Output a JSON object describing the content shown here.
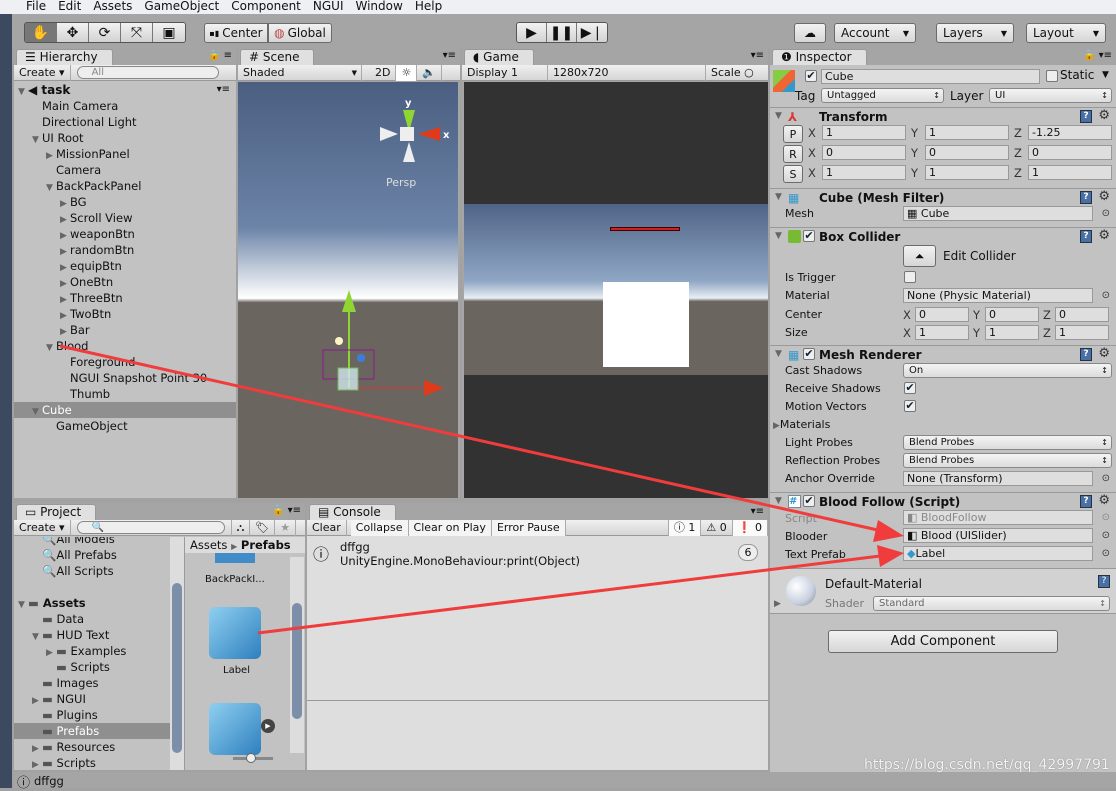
{
  "menu": [
    "File",
    "Edit",
    "Assets",
    "GameObject",
    "Component",
    "NGUI",
    "Window",
    "Help"
  ],
  "toolbar": {
    "tools": [
      "hand-tool",
      "move-tool",
      "rotate-tool",
      "scale-tool",
      "rect-tool"
    ],
    "pivot": "Center",
    "space": "Global",
    "account": "Account",
    "layers": "Layers",
    "layout": "Layout"
  },
  "hierarchy": {
    "tab": "Hierarchy",
    "create": "Create",
    "search_placeholder": "All",
    "scene": "task",
    "items": [
      {
        "label": "Main Camera",
        "depth": 1,
        "arrow": ""
      },
      {
        "label": "Directional Light",
        "depth": 1,
        "arrow": ""
      },
      {
        "label": "UI Root",
        "depth": 1,
        "arrow": "open"
      },
      {
        "label": "MissionPanel",
        "depth": 2,
        "arrow": "closed"
      },
      {
        "label": "Camera",
        "depth": 2,
        "arrow": ""
      },
      {
        "label": "BackPackPanel",
        "depth": 2,
        "arrow": "open"
      },
      {
        "label": "BG",
        "depth": 3,
        "arrow": "closed"
      },
      {
        "label": "Scroll View",
        "depth": 3,
        "arrow": "closed"
      },
      {
        "label": "weaponBtn",
        "depth": 3,
        "arrow": "closed"
      },
      {
        "label": "randomBtn",
        "depth": 3,
        "arrow": "closed"
      },
      {
        "label": "equipBtn",
        "depth": 3,
        "arrow": "closed"
      },
      {
        "label": "OneBtn",
        "depth": 3,
        "arrow": "closed"
      },
      {
        "label": "ThreeBtn",
        "depth": 3,
        "arrow": "closed"
      },
      {
        "label": "TwoBtn",
        "depth": 3,
        "arrow": "closed"
      },
      {
        "label": "Bar",
        "depth": 3,
        "arrow": "closed"
      },
      {
        "label": "Blood",
        "depth": 2,
        "arrow": "open"
      },
      {
        "label": "Foreground",
        "depth": 3,
        "arrow": ""
      },
      {
        "label": "NGUI Snapshot Point 30",
        "depth": 3,
        "arrow": ""
      },
      {
        "label": "Thumb",
        "depth": 3,
        "arrow": ""
      },
      {
        "label": "Cube",
        "depth": 1,
        "arrow": "open",
        "selected": true
      },
      {
        "label": "GameObject",
        "depth": 2,
        "arrow": ""
      }
    ]
  },
  "scene": {
    "tab": "Scene",
    "shading": "Shaded",
    "mode2d": "2D",
    "persp": "Persp",
    "axis_x": "x",
    "axis_y": "y"
  },
  "game": {
    "tab": "Game",
    "display": "Display 1",
    "resolution": "1280x720",
    "scale": "Scale"
  },
  "inspector": {
    "tab": "Inspector",
    "name": "Cube",
    "static": "Static",
    "tag_label": "Tag",
    "tag": "Untagged",
    "layer_label": "Layer",
    "layer": "UI",
    "transform": {
      "title": "Transform",
      "rows": [
        {
          "btn": "P",
          "x": "1",
          "y": "1",
          "z": "-1.25"
        },
        {
          "btn": "R",
          "x": "0",
          "y": "0",
          "z": "0"
        },
        {
          "btn": "S",
          "x": "1",
          "y": "1",
          "z": "1"
        }
      ]
    },
    "mesh_filter": {
      "title": "Cube (Mesh Filter)",
      "mesh_label": "Mesh",
      "mesh": "Cube"
    },
    "box_collider": {
      "title": "Box Collider",
      "edit": "Edit Collider",
      "is_trigger": "Is Trigger",
      "material_label": "Material",
      "material": "None (Physic Material)",
      "center_label": "Center",
      "center": [
        "0",
        "0",
        "0"
      ],
      "size_label": "Size",
      "size": [
        "1",
        "1",
        "1"
      ]
    },
    "mesh_renderer": {
      "title": "Mesh Renderer",
      "cast_label": "Cast Shadows",
      "cast": "On",
      "receive_label": "Receive Shadows",
      "motion_label": "Motion Vectors",
      "materials": "Materials",
      "light_label": "Light Probes",
      "light": "Blend Probes",
      "refl_label": "Reflection Probes",
      "refl": "Blend Probes",
      "anchor_label": "Anchor Override",
      "anchor": "None (Transform)"
    },
    "blood_follow": {
      "title": "Blood Follow (Script)",
      "script_label": "Script",
      "script": "BloodFollow",
      "blooder_label": "Blooder",
      "blooder": "Blood (UISlider)",
      "prefab_label": "Text Prefab",
      "prefab": "Label"
    },
    "material": {
      "name": "Default-Material",
      "shader_label": "Shader",
      "shader": "Standard"
    },
    "add_component": "Add Component"
  },
  "project": {
    "tab": "Project",
    "create": "Create",
    "favorites": [
      "All Models",
      "All Prefabs",
      "All Scripts"
    ],
    "tree": [
      {
        "label": "Assets",
        "depth": 0,
        "arrow": "open",
        "bold": true
      },
      {
        "label": "Data",
        "depth": 1,
        "arrow": ""
      },
      {
        "label": "HUD Text",
        "depth": 1,
        "arrow": "open"
      },
      {
        "label": "Examples",
        "depth": 2,
        "arrow": "closed"
      },
      {
        "label": "Scripts",
        "depth": 2,
        "arrow": ""
      },
      {
        "label": "Images",
        "depth": 1,
        "arrow": ""
      },
      {
        "label": "NGUI",
        "depth": 1,
        "arrow": "closed"
      },
      {
        "label": "Plugins",
        "depth": 1,
        "arrow": ""
      },
      {
        "label": "Prefabs",
        "depth": 1,
        "arrow": "",
        "selected": true
      },
      {
        "label": "Resources",
        "depth": 1,
        "arrow": "closed"
      },
      {
        "label": "Scripts",
        "depth": 1,
        "arrow": "closed"
      }
    ],
    "breadcrumb": [
      "Assets",
      "Prefabs"
    ],
    "assets": [
      "BackPackI...",
      "Label",
      ""
    ]
  },
  "console": {
    "tab": "Console",
    "buttons": [
      "Clear",
      "Collapse",
      "Clear on Play",
      "Error Pause"
    ],
    "counts": {
      "log": "1",
      "warn": "0",
      "error": "0"
    },
    "entry": {
      "line1": "dffgg",
      "line2": "UnityEngine.MonoBehaviour:print(Object)",
      "count": "6"
    }
  },
  "status": {
    "message": "dffgg"
  },
  "watermark": "https://blog.csdn.net/qq_42997791",
  "colors": {
    "annotation_arrow": "#f03c3c",
    "selection": "#8f8f8f",
    "sky": "#4d6284",
    "ground": "#6b6560"
  }
}
